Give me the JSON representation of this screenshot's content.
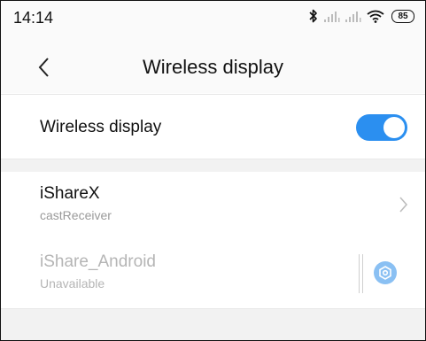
{
  "status_bar": {
    "time": "14:14",
    "battery": "85",
    "icons": [
      "bluetooth-icon",
      "signal-icon",
      "signal-icon",
      "wifi-icon",
      "battery-icon"
    ]
  },
  "header": {
    "title": "Wireless display",
    "back_icon": "back-arrow-icon"
  },
  "toggle": {
    "label": "Wireless display",
    "on": true,
    "accent": "#2b8ff0"
  },
  "devices": [
    {
      "name": "iShareX",
      "subtitle": "castReceiver",
      "action_icon": "chevron-right-icon"
    },
    {
      "name": "iShare_Android",
      "subtitle": "Unavailable",
      "action_icon": "settings-gear-icon",
      "disabled": true
    }
  ]
}
